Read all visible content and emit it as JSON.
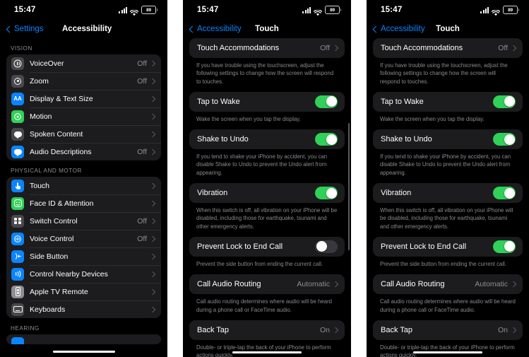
{
  "status_bar": {
    "time": "15:47",
    "battery": "89",
    "signal_icon": "cellular-signal-icon",
    "wifi_icon": "wifi-icon",
    "battery_icon": "battery-icon"
  },
  "panel1": {
    "nav": {
      "back_label": "Settings",
      "title": "Accessibility"
    },
    "sections": [
      {
        "header": "VISION",
        "items": [
          {
            "label": "VoiceOver",
            "value": "Off",
            "icon": "voiceover-icon",
            "icon_color": "#48484a"
          },
          {
            "label": "Zoom",
            "value": "Off",
            "icon": "zoom-icon",
            "icon_color": "#48484a"
          },
          {
            "label": "Display & Text Size",
            "value": "",
            "icon": "display-text-size-icon",
            "icon_color": "#0a84ff"
          },
          {
            "label": "Motion",
            "value": "",
            "icon": "motion-icon",
            "icon_color": "#30d158"
          },
          {
            "label": "Spoken Content",
            "value": "",
            "icon": "spoken-content-icon",
            "icon_color": "#48484a"
          },
          {
            "label": "Audio Descriptions",
            "value": "Off",
            "icon": "audio-descriptions-icon",
            "icon_color": "#0a84ff"
          }
        ]
      },
      {
        "header": "PHYSICAL AND MOTOR",
        "items": [
          {
            "label": "Touch",
            "value": "",
            "icon": "touch-icon",
            "icon_color": "#0a84ff"
          },
          {
            "label": "Face ID & Attention",
            "value": "",
            "icon": "face-id-icon",
            "icon_color": "#30d158"
          },
          {
            "label": "Switch Control",
            "value": "Off",
            "icon": "switch-control-icon",
            "icon_color": "#48484a"
          },
          {
            "label": "Voice Control",
            "value": "Off",
            "icon": "voice-control-icon",
            "icon_color": "#0a84ff"
          },
          {
            "label": "Side Button",
            "value": "",
            "icon": "side-button-icon",
            "icon_color": "#0a84ff"
          },
          {
            "label": "Control Nearby Devices",
            "value": "",
            "icon": "control-nearby-devices-icon",
            "icon_color": "#0a84ff"
          },
          {
            "label": "Apple TV Remote",
            "value": "",
            "icon": "apple-tv-remote-icon",
            "icon_color": "#8e8e93"
          },
          {
            "label": "Keyboards",
            "value": "",
            "icon": "keyboards-icon",
            "icon_color": "#48484a"
          }
        ]
      },
      {
        "header": "HEARING",
        "items": []
      }
    ]
  },
  "panel2": {
    "nav": {
      "back_label": "Accessibility",
      "title": "Touch"
    },
    "rows": [
      {
        "type": "link",
        "label": "Touch Accommodations",
        "value": "Off",
        "footnote": "If you have trouble using the touchscreen, adjust the following settings to change how the screen will respond to touches."
      },
      {
        "type": "toggle",
        "label": "Tap to Wake",
        "state": "on",
        "footnote": "Wake the screen when you tap the display."
      },
      {
        "type": "toggle",
        "label": "Shake to Undo",
        "state": "on",
        "footnote": "If you tend to shake your iPhone by accident, you can disable Shake to Undo to prevent the Undo alert from appearing."
      },
      {
        "type": "toggle",
        "label": "Vibration",
        "state": "on",
        "footnote": "When this switch is off, all vibration on your iPhone will be disabled, including those for earthquake, tsunami and other emergency alerts."
      },
      {
        "type": "toggle",
        "label": "Prevent Lock to End Call",
        "state": "off",
        "footnote": "Prevent the side button from ending the current call."
      },
      {
        "type": "link",
        "label": "Call Audio Routing",
        "value": "Automatic",
        "footnote": "Call audio routing determines where audio will be heard during a phone call or FaceTime audio."
      },
      {
        "type": "link",
        "label": "Back Tap",
        "value": "On",
        "footnote": "Double- or triple-tap the back of your iPhone to perform actions quickly."
      }
    ]
  },
  "panel3": {
    "nav": {
      "back_label": "Accessibility",
      "title": "Touch"
    },
    "rows": [
      {
        "type": "link",
        "label": "Touch Accommodations",
        "value": "Off",
        "footnote": "If you have trouble using the touchscreen, adjust the following settings to change how the screen will respond to touches."
      },
      {
        "type": "toggle",
        "label": "Tap to Wake",
        "state": "on",
        "footnote": "Wake the screen when you tap the display."
      },
      {
        "type": "toggle",
        "label": "Shake to Undo",
        "state": "on",
        "footnote": "If you tend to shake your iPhone by accident, you can disable Shake to Undo to prevent the Undo alert from appearing."
      },
      {
        "type": "toggle",
        "label": "Vibration",
        "state": "on",
        "footnote": "When this switch is off, all vibration on your iPhone will be disabled, including those for earthquake, tsunami and other emergency alerts."
      },
      {
        "type": "toggle",
        "label": "Prevent Lock to End Call",
        "state": "on",
        "footnote": "Prevent the side button from ending the current call."
      },
      {
        "type": "link",
        "label": "Call Audio Routing",
        "value": "Automatic",
        "footnote": "Call audio routing determines where audio will be heard during a phone call or FaceTime audio."
      },
      {
        "type": "link",
        "label": "Back Tap",
        "value": "On",
        "footnote": "Double- or triple-tap the back of your iPhone to perform actions quickly."
      }
    ]
  },
  "colors": {
    "accent_blue": "#0a84ff",
    "toggle_green": "#30d158",
    "card_bg": "#1c1c1e",
    "page_bg": "#000000",
    "secondary_text": "#8e8e93"
  }
}
